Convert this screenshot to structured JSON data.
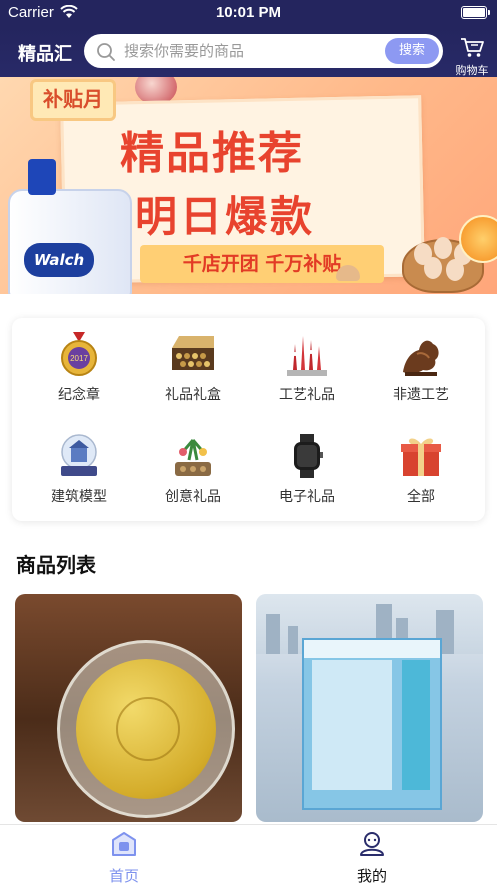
{
  "status_bar": {
    "carrier": "Carrier",
    "time": "10:01 PM"
  },
  "header": {
    "title": "精品汇",
    "search_placeholder": "搜索你需要的商品",
    "search_button": "搜索",
    "cart_label": "购物车"
  },
  "banner": {
    "tag": "补贴月",
    "headline_1": "精品推荐",
    "headline_2": "明日爆款",
    "ribbon": "千店开团 千万补贴",
    "product_brand": "Walch"
  },
  "categories": [
    {
      "label": "纪念章",
      "icon": "medal-icon"
    },
    {
      "label": "礼品礼盒",
      "icon": "gift-box-icon"
    },
    {
      "label": "工艺礼品",
      "icon": "craft-icon"
    },
    {
      "label": "非遗工艺",
      "icon": "carving-icon"
    },
    {
      "label": "建筑模型",
      "icon": "snow-globe-icon"
    },
    {
      "label": "创意礼品",
      "icon": "plant-icon"
    },
    {
      "label": "电子礼品",
      "icon": "smartwatch-icon"
    },
    {
      "label": "全部",
      "icon": "gift-icon"
    }
  ],
  "product_section": {
    "title": "商品列表"
  },
  "tab_bar": {
    "home": "首页",
    "mine": "我的",
    "active_color": "#7e92ee"
  },
  "colors": {
    "nav_bg": "#24255e",
    "accent": "#8d99f2"
  }
}
